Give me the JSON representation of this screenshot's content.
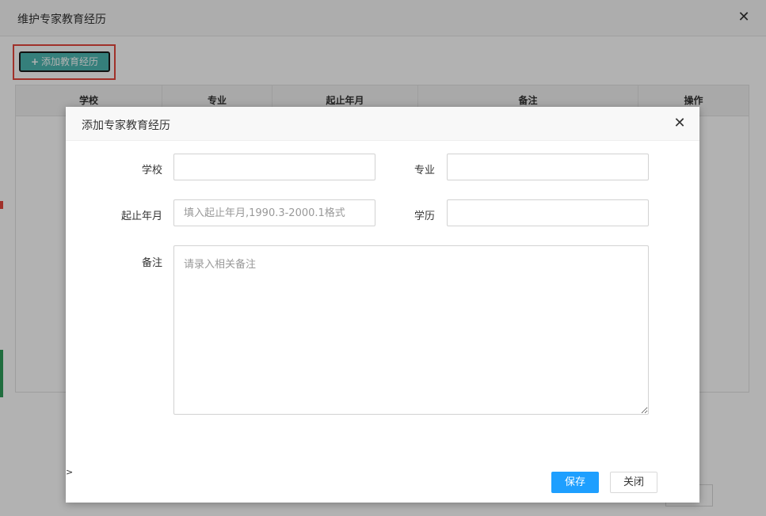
{
  "outer_modal": {
    "title": "维护专家教育经历",
    "close_symbol": "✕",
    "add_button": {
      "icon": "+",
      "label": "添加教育经历",
      "color": "#4cb6b0"
    },
    "table": {
      "headers": [
        "学校",
        "专业",
        "起止年月",
        "备注",
        "操作"
      ]
    }
  },
  "inner_modal": {
    "title": "添加专家教育经历",
    "close_symbol": "✕",
    "form": {
      "school": {
        "label": "学校",
        "value": "",
        "placeholder": ""
      },
      "major": {
        "label": "专业",
        "value": "",
        "placeholder": ""
      },
      "period": {
        "label": "起止年月",
        "value": "",
        "placeholder": "填入起止年月,1990.3-2000.1格式"
      },
      "degree": {
        "label": "学历",
        "value": "",
        "placeholder": ""
      },
      "remark": {
        "label": "备注",
        "value": "",
        "placeholder": "请录入相关备注"
      }
    },
    "caret_text": ">",
    "buttons": {
      "save": "保存",
      "close": "关闭"
    },
    "colors": {
      "primary": "#1e9fff"
    }
  },
  "colors": {
    "highlight_box": "#e5473d"
  }
}
